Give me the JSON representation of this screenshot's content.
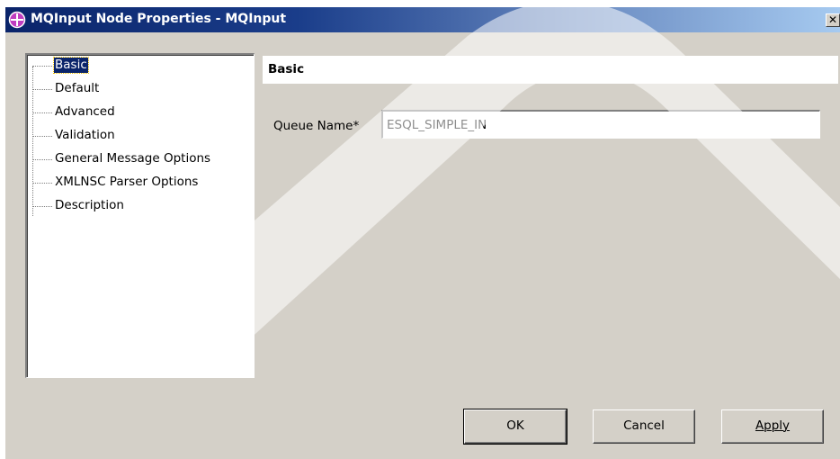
{
  "window": {
    "title": "MQInput Node Properties - MQInput",
    "close_glyph": "✕"
  },
  "nav": {
    "items": [
      {
        "label": "Basic",
        "selected": true
      },
      {
        "label": "Default"
      },
      {
        "label": "Advanced"
      },
      {
        "label": "Validation"
      },
      {
        "label": "General Message Options"
      },
      {
        "label": "XMLNSC Parser Options"
      },
      {
        "label": "Description"
      }
    ]
  },
  "section": {
    "title": "Basic"
  },
  "form": {
    "queue_name_label": "Queue Name*",
    "queue_name_value": "ESQL_SIMPLE_IN"
  },
  "buttons": {
    "ok": "OK",
    "cancel": "Cancel",
    "apply": "Apply"
  },
  "colors": {
    "titlebar_start": "#0a246a",
    "titlebar_end": "#a6caf0",
    "window_bg": "#d4d0c8",
    "selection": "#0a246a"
  },
  "icons": {
    "app": "mqinput-node-icon",
    "close": "close-icon"
  }
}
